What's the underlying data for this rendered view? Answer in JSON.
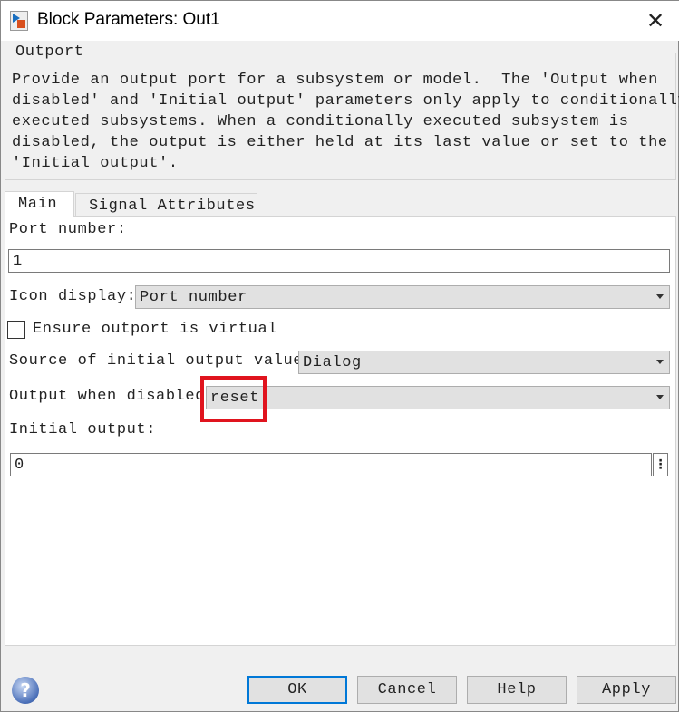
{
  "window": {
    "title": "Block Parameters: Out1"
  },
  "group": {
    "legend": "Outport",
    "description": "Provide an output port for a subsystem or model.  The 'Output when\ndisabled' and 'Initial output' parameters only apply to conditionally\nexecuted subsystems. When a conditionally executed subsystem is\ndisabled, the output is either held at its last value or set to the\n'Initial output'."
  },
  "tabs": [
    {
      "label": "Main",
      "selected": true
    },
    {
      "label": "Signal Attributes",
      "selected": false
    }
  ],
  "main": {
    "port_number_label": "Port number:",
    "port_number_value": "1",
    "icon_display_label": "Icon display:",
    "icon_display_value": "Port number",
    "virtual_label": "Ensure outport is virtual",
    "virtual_checked": false,
    "source_label": "Source of initial output value:",
    "source_value": "Dialog",
    "disabled_label": "Output when disabled:",
    "disabled_value": "reset",
    "initial_label": "Initial output:",
    "initial_value": "0"
  },
  "highlight_color": "#e0141e",
  "buttons": {
    "ok": "OK",
    "cancel": "Cancel",
    "help": "Help",
    "apply": "Apply"
  }
}
